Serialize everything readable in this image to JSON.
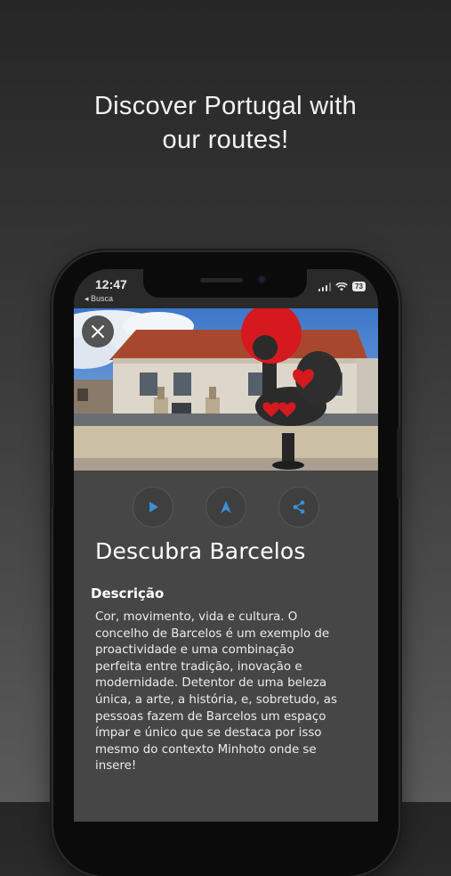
{
  "headline": {
    "line1": "Discover Portugal with",
    "line2": "our routes!"
  },
  "status": {
    "time": "12:47",
    "back_app": "◂ Busca",
    "battery": "73"
  },
  "icons": {
    "close": "close-icon",
    "play": "play-icon",
    "navigate": "navigation-arrow-icon",
    "share": "share-icon",
    "accent": "#3a8fd8"
  },
  "place": {
    "title": "Descubra Barcelos",
    "description_label": "Descrição",
    "description_lines": [
      "Cor, movimento, vida e cultura. O",
      "concelho de Barcelos é um exemplo de",
      "proactividade e uma combinação",
      "perfeita entre tradição, inovação e",
      "modernidade. Detentor de uma beleza",
      "única, a arte, a história, e, sobretudo, as",
      "pessoas fazem de Barcelos um espaço",
      "ímpar e único que se destaca por isso",
      "mesmo do contexto Minhoto onde se",
      "insere!"
    ]
  }
}
